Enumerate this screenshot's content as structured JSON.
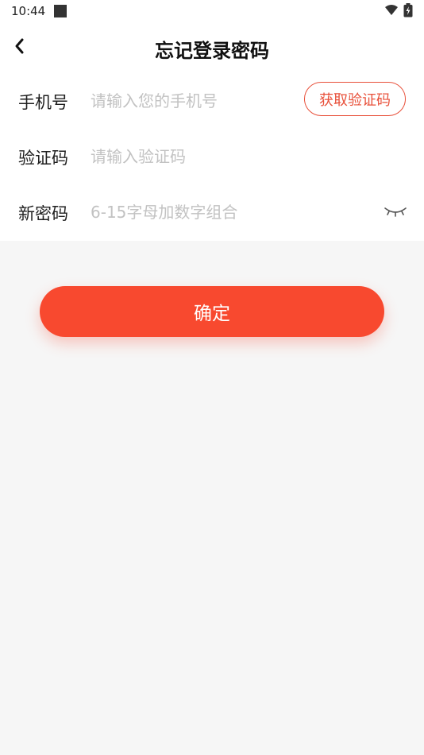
{
  "status_bar": {
    "time": "10:44"
  },
  "header": {
    "back_icon": "chevron-left-icon",
    "title": "忘记登录密码"
  },
  "form": {
    "phone": {
      "label": "手机号",
      "placeholder": "请输入您的手机号",
      "value": "",
      "send_code_label": "获取验证码"
    },
    "code": {
      "label": "验证码",
      "placeholder": "请输入验证码",
      "value": ""
    },
    "password": {
      "label": "新密码",
      "placeholder": "6-15字母加数字组合",
      "value": "",
      "toggle_icon": "eye-closed-icon"
    }
  },
  "actions": {
    "confirm_label": "确定"
  },
  "colors": {
    "accent": "#f8492f",
    "accent_outline": "#e8503a",
    "background": "#f6f6f6",
    "card": "#ffffff",
    "placeholder": "#c2c2c2"
  }
}
